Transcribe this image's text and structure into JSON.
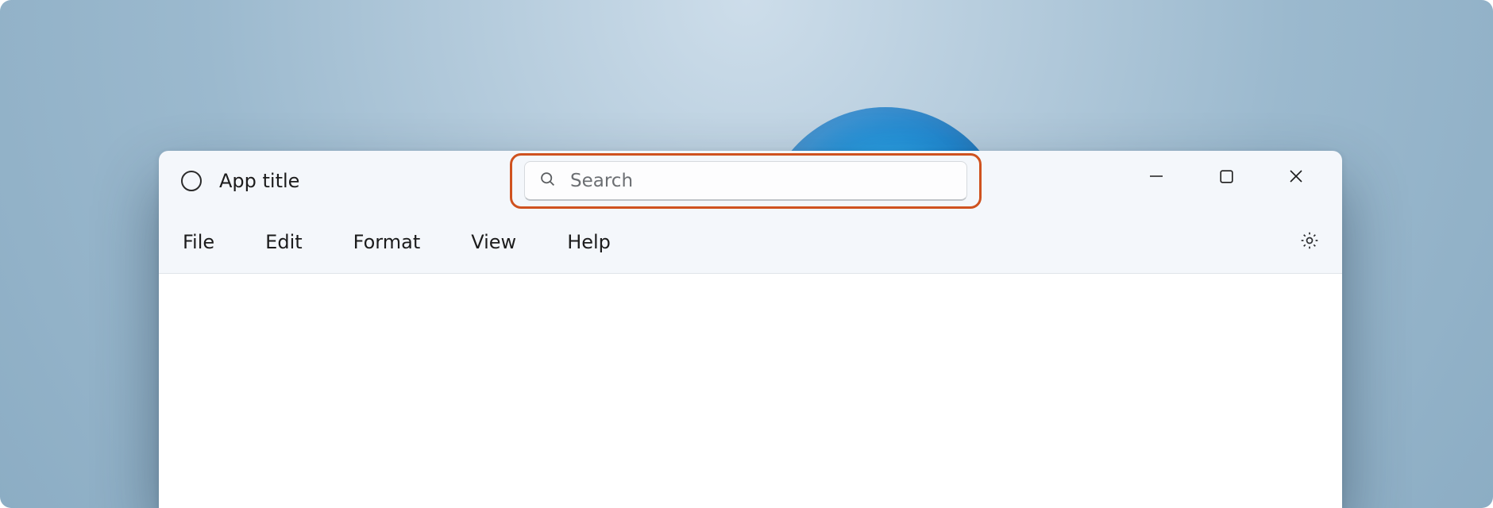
{
  "titlebar": {
    "app_title": "App title"
  },
  "search": {
    "placeholder": "Search",
    "value": ""
  },
  "menubar": {
    "items": [
      {
        "label": "File"
      },
      {
        "label": "Edit"
      },
      {
        "label": "Format"
      },
      {
        "label": "View"
      },
      {
        "label": "Help"
      }
    ]
  },
  "callout_color": "#cf521f"
}
